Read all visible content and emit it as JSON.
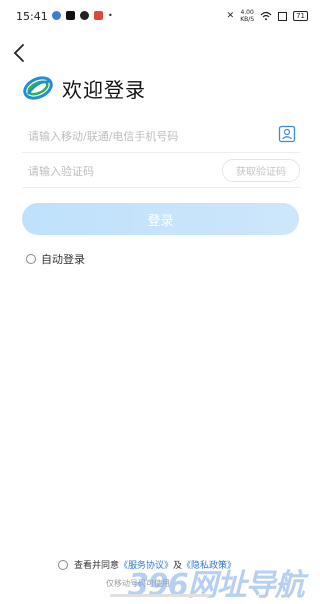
{
  "status": {
    "time": "15:41",
    "speed_value": "4.00",
    "speed_unit": "KB/S",
    "battery": "71"
  },
  "header": {
    "title": "欢迎登录"
  },
  "form": {
    "phone_placeholder": "请输入移动/联通/电信手机号码",
    "code_placeholder": "请输入验证码",
    "get_code_label": "获取验证码",
    "login_label": "登录",
    "auto_login_label": "自动登录"
  },
  "agreement": {
    "prefix": "查看并同意",
    "service_link": "《服务协议》",
    "and": "及",
    "privacy_link": "《隐私政策》",
    "note": "仅移动号码可使用"
  },
  "watermark": {
    "text": "396网址导航"
  },
  "colors": {
    "accent": "#2f78d6",
    "button": "#c6e3fb"
  }
}
